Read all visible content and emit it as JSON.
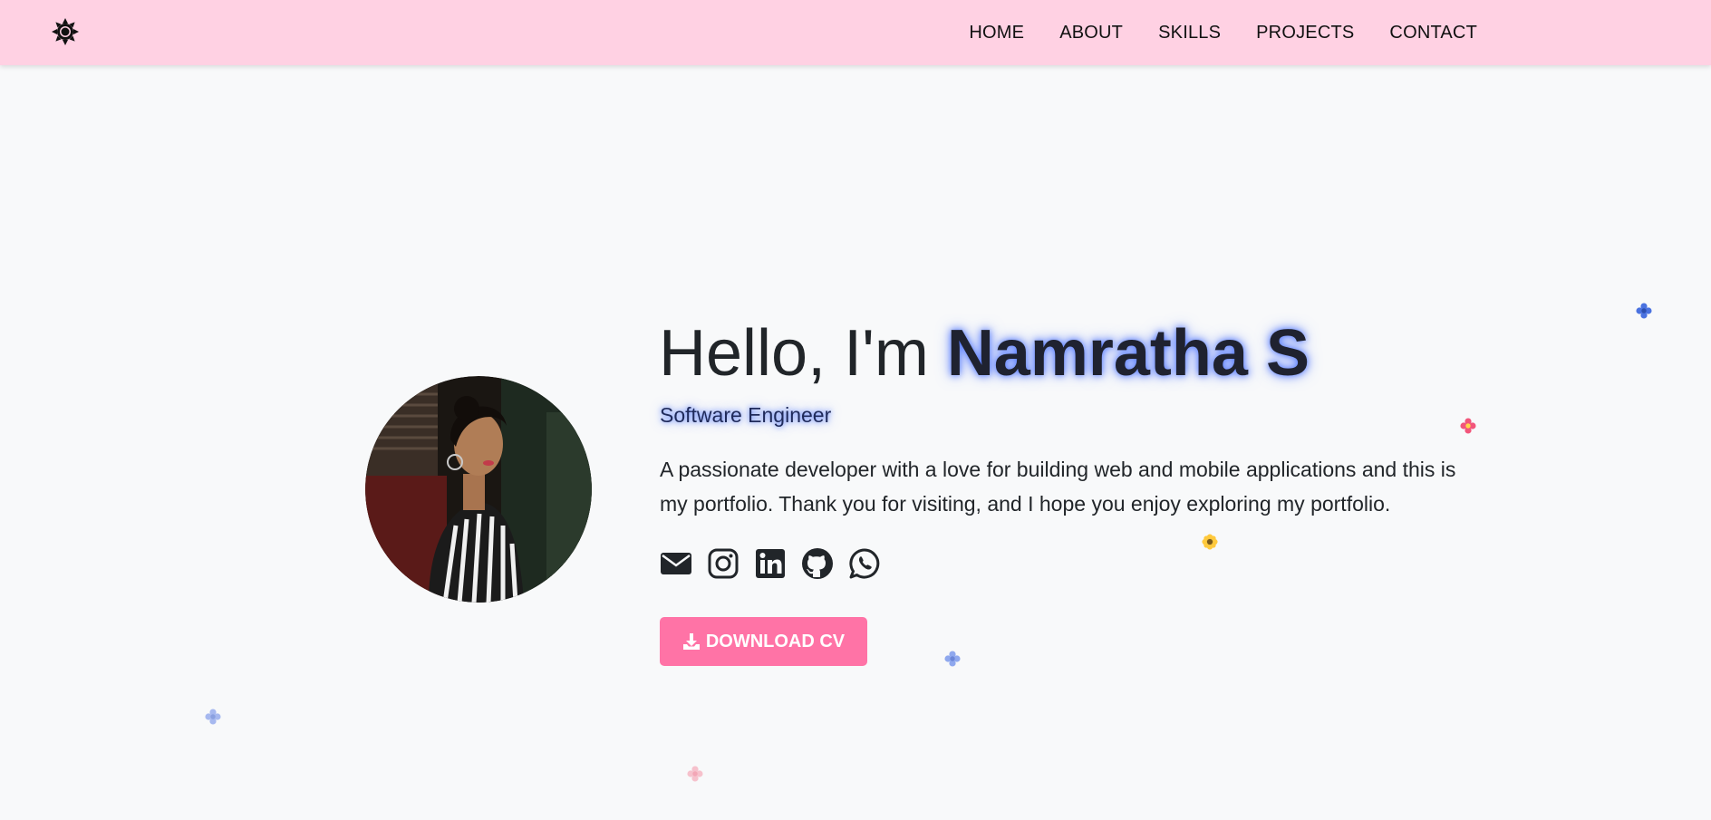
{
  "nav": {
    "theme_icon": "sun-icon",
    "items": [
      {
        "label": "HOME"
      },
      {
        "label": "ABOUT"
      },
      {
        "label": "SKILLS"
      },
      {
        "label": "PROJECTS"
      },
      {
        "label": "CONTACT"
      }
    ]
  },
  "hero": {
    "greeting": "Hello, I'm ",
    "name": "Namratha S",
    "role": "Software Engineer",
    "description": "A passionate developer with a love for building web and mobile applications and this is my portfolio. Thank you for visiting, and I hope you enjoy exploring my portfolio.",
    "cv_button_label": "DOWNLOAD CV"
  },
  "socials": [
    {
      "name": "email-icon"
    },
    {
      "name": "instagram-icon"
    },
    {
      "name": "linkedin-icon"
    },
    {
      "name": "github-icon"
    },
    {
      "name": "whatsapp-icon"
    }
  ],
  "colors": {
    "navbar_bg": "#ffd1e3",
    "page_bg": "#f8f9fa",
    "accent_pink": "#ff73a6",
    "glow_blue": "#466eff",
    "text": "#212529"
  }
}
